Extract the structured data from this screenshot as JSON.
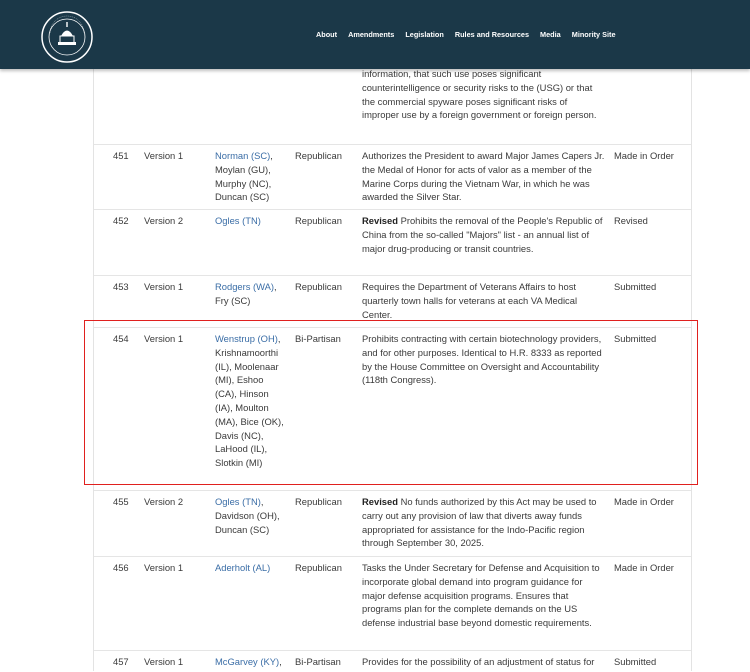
{
  "header": {
    "logo_text": "COMMITTEE ON RULES",
    "nav": [
      "About",
      "Amendments",
      "Legislation",
      "Rules and Resources",
      "Media",
      "Minority Site"
    ]
  },
  "top_partial_description": "information, that such use poses significant counterintelligence or security risks to the (USG) or that the commercial spyware poses significant risks of improper use by a foreign government or foreign person.",
  "rows": [
    {
      "number": "451",
      "version": "Version 1",
      "sponsor_link": "Norman (SC)",
      "sponsor_rest": ", Moylan (GU), Murphy (NC), Duncan (SC)",
      "party": "Republican",
      "revised": "",
      "description": "Authorizes the President to award Major James Capers Jr. the Medal of Honor for acts of valor as a member of the Marine Corps during the Vietnam War, in which he was awarded the Silver Star.",
      "status": "Made in Order"
    },
    {
      "number": "452",
      "version": "Version 2",
      "sponsor_link": "Ogles (TN)",
      "sponsor_rest": "",
      "party": "Republican",
      "revised": "Revised",
      "description": " Prohibits the removal of the People's Republic of China from the so-called \"Majors\" list - an annual list of major drug-producing or transit countries.",
      "status": "Revised"
    },
    {
      "number": "453",
      "version": "Version 1",
      "sponsor_link": "Rodgers (WA)",
      "sponsor_rest": ", Fry (SC)",
      "party": "Republican",
      "revised": "",
      "description": "Requires the Department of Veterans Affairs to host quarterly town halls for veterans at each VA Medical Center.",
      "status": "Submitted"
    },
    {
      "number": "454",
      "version": "Version 1",
      "sponsor_link": "Wenstrup (OH)",
      "sponsor_rest": ", Krishnamoorthi (IL), Moolenaar (MI), Eshoo (CA), Hinson (IA), Moulton (MA), Bice (OK), Davis (NC), LaHood (IL), Slotkin (MI)",
      "party": "Bi-Partisan",
      "revised": "",
      "description": "Prohibits contracting with certain biotechnology providers, and for other purposes. Identical to H.R. 8333 as reported by the House Committee on Oversight and Accountability (118th Congress).",
      "status": "Submitted"
    },
    {
      "number": "455",
      "version": "Version 2",
      "sponsor_link": "Ogles (TN)",
      "sponsor_rest": ", Davidson (OH), Duncan (SC)",
      "party": "Republican",
      "revised": "Revised",
      "description": " No funds authorized by this Act may be used to carry out any provision of law that diverts away funds appropriated for assistance for the Indo-Pacific region through September 30, 2025.",
      "status": "Made in Order"
    },
    {
      "number": "456",
      "version": "Version 1",
      "sponsor_link": "Aderholt (AL)",
      "sponsor_rest": "",
      "party": "Republican",
      "revised": "",
      "description": "Tasks the Under Secretary for Defense and Acquisition to incorporate global demand into program guidance for major defense acquisition programs. Ensures that programs plan for the complete demands on the US defense industrial base beyond domestic requirements.",
      "status": "Made in Order"
    },
    {
      "number": "457",
      "version": "Version 1",
      "sponsor_link": "McGarvey (KY)",
      "sponsor_rest": ", Calvert (CA)",
      "party": "Bi-Partisan",
      "revised": "",
      "description": "Provides for the possibility of an adjustment of status for the families of eligible Cuban and Haitian nationals.",
      "status": "Submitted"
    }
  ]
}
